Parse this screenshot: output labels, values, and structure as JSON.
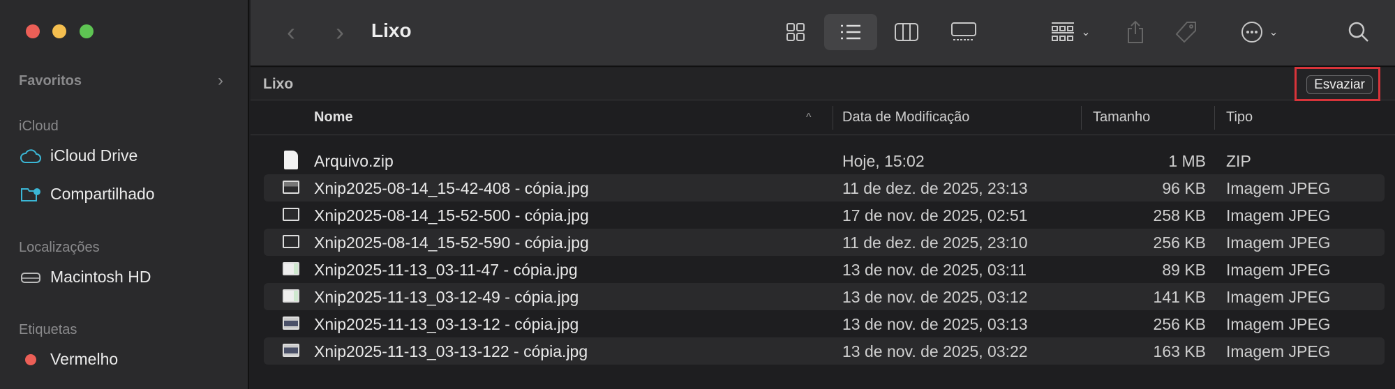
{
  "window": {
    "title": "Lixo"
  },
  "sidebar": {
    "favorites_label": "Favoritos",
    "icloud_label": "iCloud",
    "icloud_items": [
      {
        "label": "iCloud Drive",
        "icon": "cloud-icon"
      },
      {
        "label": "Compartilhado",
        "icon": "shared-folder-icon"
      }
    ],
    "locations_label": "Localizações",
    "location_items": [
      {
        "label": "Macintosh HD",
        "icon": "hard-drive-icon"
      }
    ],
    "tags_label": "Etiquetas",
    "tag_items": [
      {
        "label": "Vermelho",
        "color": "#ec5f57"
      }
    ]
  },
  "pathbar": {
    "label": "Lixo",
    "empty_button": "Esvaziar"
  },
  "columns": {
    "name": "Nome",
    "date": "Data de Modificação",
    "size": "Tamanho",
    "kind": "Tipo"
  },
  "files": [
    {
      "name": "Arquivo.zip",
      "date": "Hoje, 15:02",
      "size": "1 MB",
      "kind": "ZIP",
      "icon": "zip"
    },
    {
      "name": "Xnip2025-08-14_15-42-408 - cópia.jpg",
      "date": "11 de dez. de 2025, 23:13",
      "size": "96 KB",
      "kind": "Imagem JPEG",
      "icon": "img-dark-top"
    },
    {
      "name": "Xnip2025-08-14_15-52-500 - cópia.jpg",
      "date": "17 de nov. de 2025, 02:51",
      "size": "258 KB",
      "kind": "Imagem JPEG",
      "icon": "img-dark"
    },
    {
      "name": "Xnip2025-08-14_15-52-590 - cópia.jpg",
      "date": "11 de dez. de 2025, 23:10",
      "size": "256 KB",
      "kind": "Imagem JPEG",
      "icon": "img-dark"
    },
    {
      "name": "Xnip2025-11-13_03-11-47 - cópia.jpg",
      "date": "13 de nov. de 2025, 03:11",
      "size": "89 KB",
      "kind": "Imagem JPEG",
      "icon": "img-light"
    },
    {
      "name": "Xnip2025-11-13_03-12-49 - cópia.jpg",
      "date": "13 de nov. de 2025, 03:12",
      "size": "141 KB",
      "kind": "Imagem JPEG",
      "icon": "img-light"
    },
    {
      "name": "Xnip2025-11-13_03-13-12 - cópia.jpg",
      "date": "13 de nov. de 2025, 03:13",
      "size": "256 KB",
      "kind": "Imagem JPEG",
      "icon": "img-blue"
    },
    {
      "name": "Xnip2025-11-13_03-13-122 - cópia.jpg",
      "date": "13 de nov. de 2025, 03:22",
      "size": "163 KB",
      "kind": "Imagem JPEG",
      "icon": "img-blue"
    }
  ]
}
